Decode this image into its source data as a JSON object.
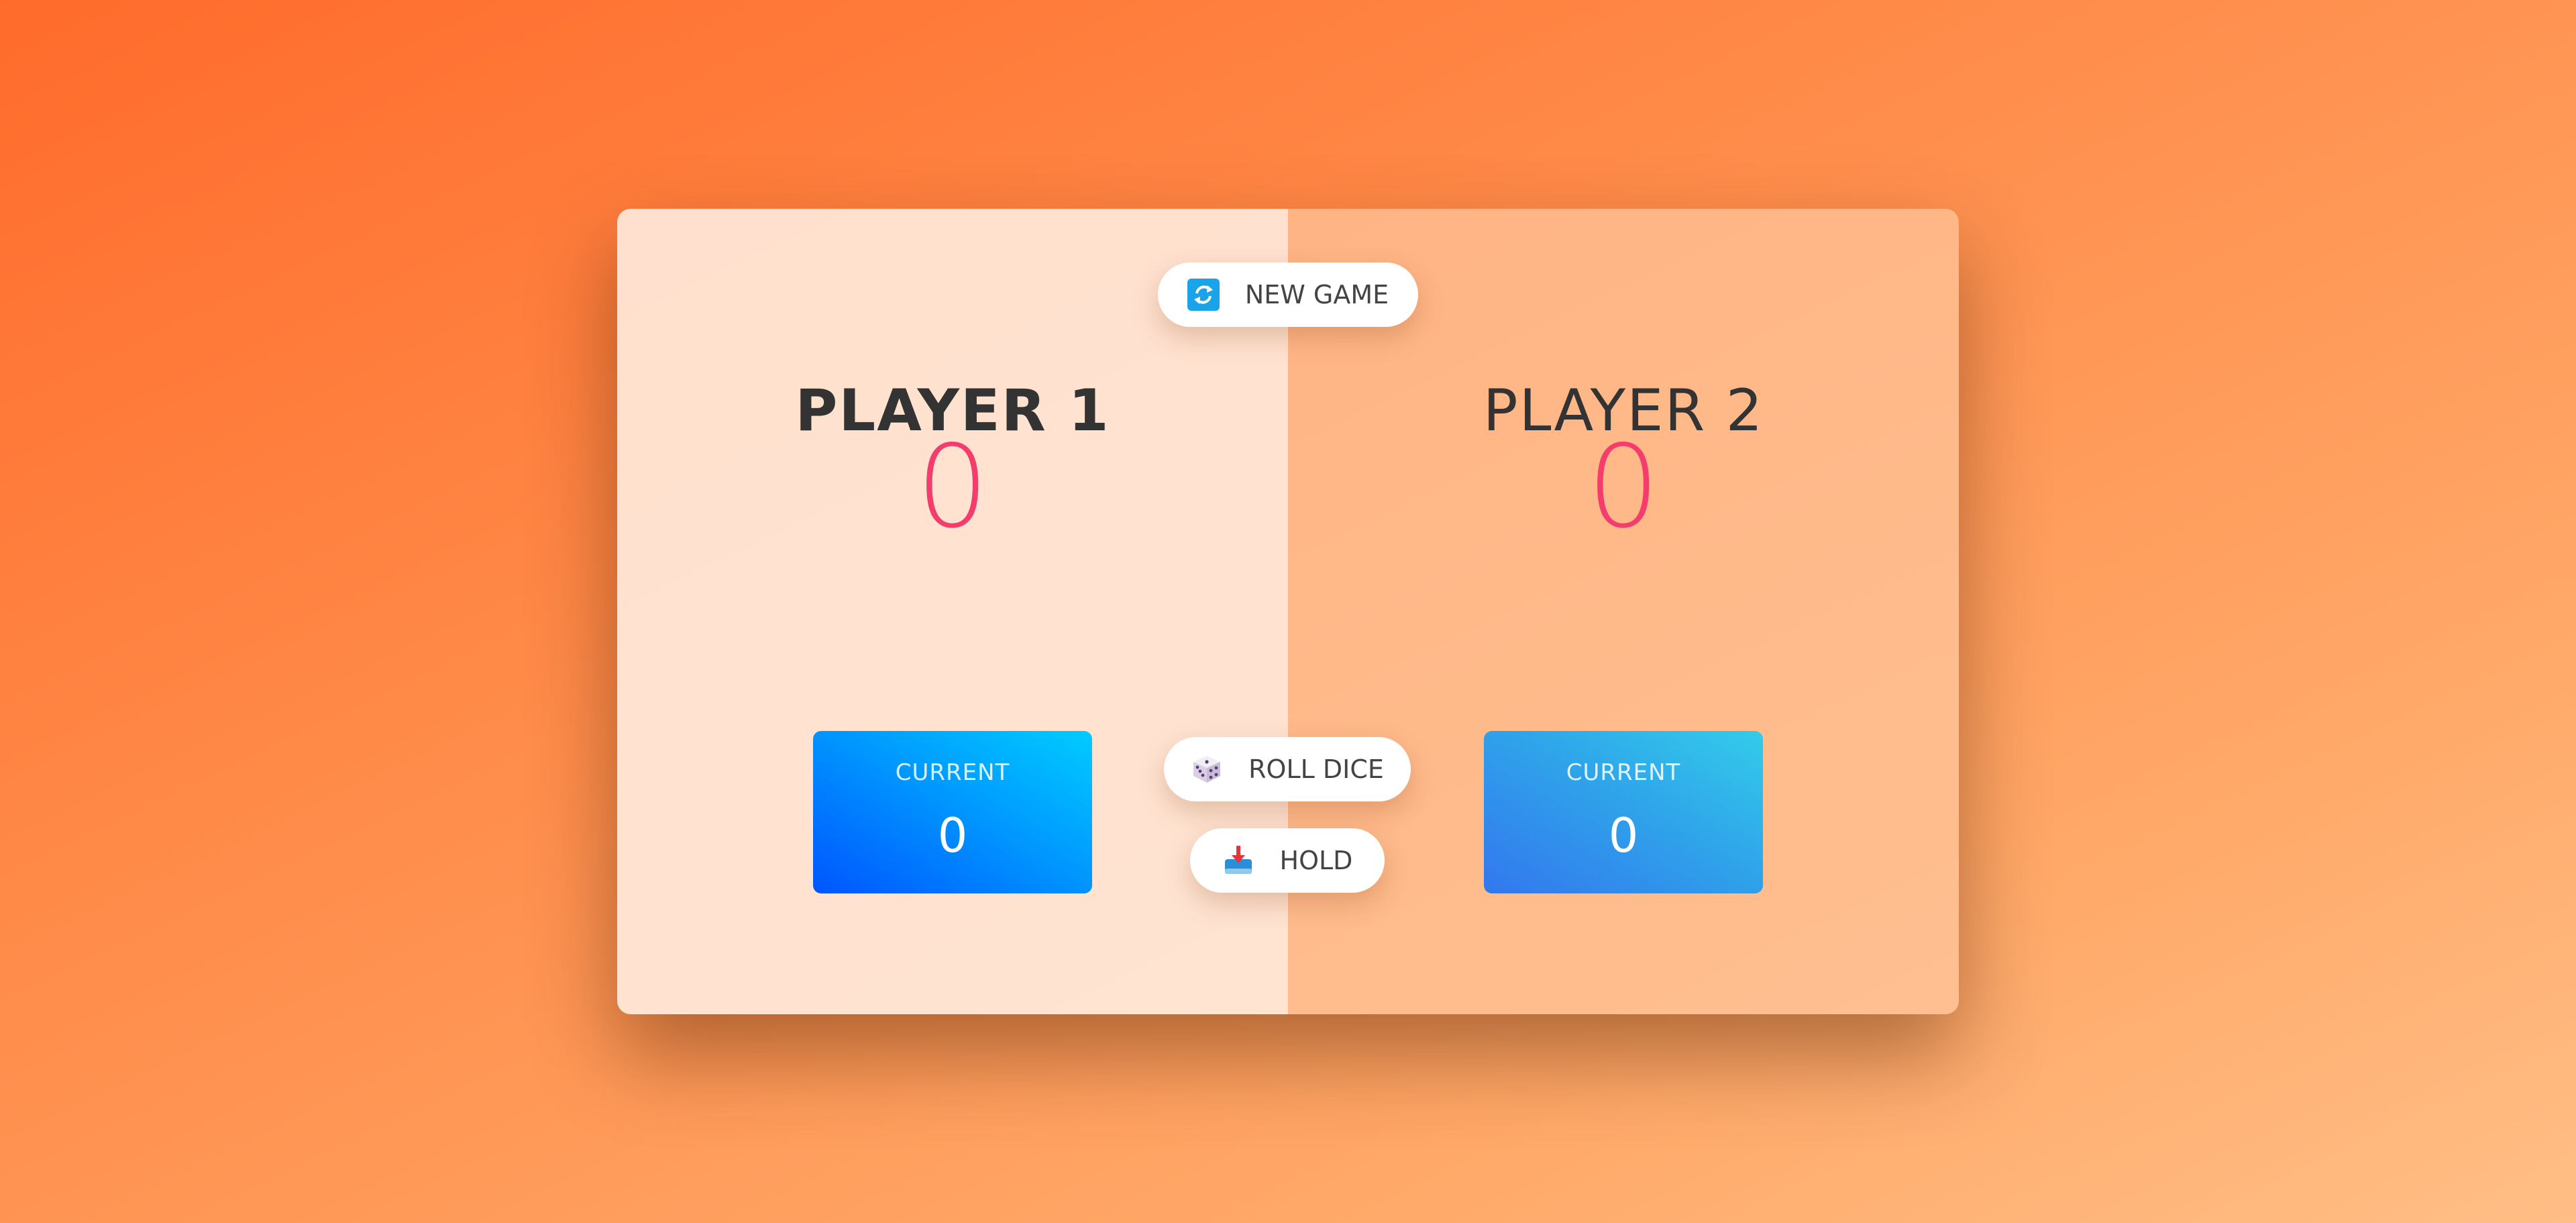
{
  "buttons": {
    "new_game": {
      "label": "NEW GAME",
      "icon": "refresh-icon"
    },
    "roll_dice": {
      "label": "ROLL DICE",
      "icon": "dice-icon"
    },
    "hold": {
      "label": "HOLD",
      "icon": "inbox-tray-icon"
    }
  },
  "players": [
    {
      "name": "PLAYER 1",
      "score": "0",
      "current_label": "CURRENT",
      "current_score": "0",
      "active": true
    },
    {
      "name": "PLAYER 2",
      "score": "0",
      "current_label": "CURRENT",
      "current_score": "0",
      "active": false
    }
  ],
  "colors": {
    "score": "#f53d6d",
    "icon_blue": "#1aa3e8"
  }
}
